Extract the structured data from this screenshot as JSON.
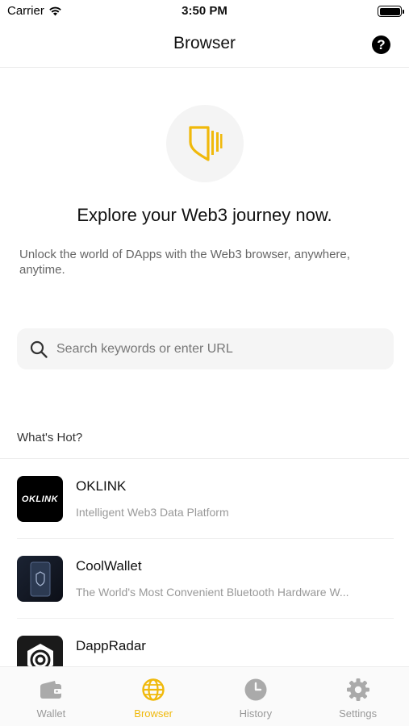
{
  "status_bar": {
    "carrier": "Carrier",
    "time": "3:50 PM"
  },
  "nav": {
    "title": "Browser",
    "help_glyph": "?"
  },
  "hero": {
    "icon": "shield-icon",
    "headline": "Explore your Web3 journey now.",
    "subtext": "Unlock the world of DApps with the Web3 browser, anywhere, anytime."
  },
  "search": {
    "placeholder": "Search keywords or enter URL",
    "value": ""
  },
  "hot": {
    "title": "What's Hot?",
    "items": [
      {
        "name": "OKLINK",
        "description": "Intelligent Web3 Data Platform",
        "logo_text": "OKLINK"
      },
      {
        "name": "CoolWallet",
        "description": "The World's Most Convenient Bluetooth Hardware W..."
      },
      {
        "name": "DappRadar",
        "description": ""
      }
    ]
  },
  "tabs": [
    {
      "label": "Wallet",
      "icon": "wallet-icon",
      "active": false
    },
    {
      "label": "Browser",
      "icon": "globe-icon",
      "active": true
    },
    {
      "label": "History",
      "icon": "clock-icon",
      "active": false
    },
    {
      "label": "Settings",
      "icon": "gear-icon",
      "active": false
    }
  ],
  "colors": {
    "accent": "#f0b90b",
    "inactive": "#999999"
  }
}
